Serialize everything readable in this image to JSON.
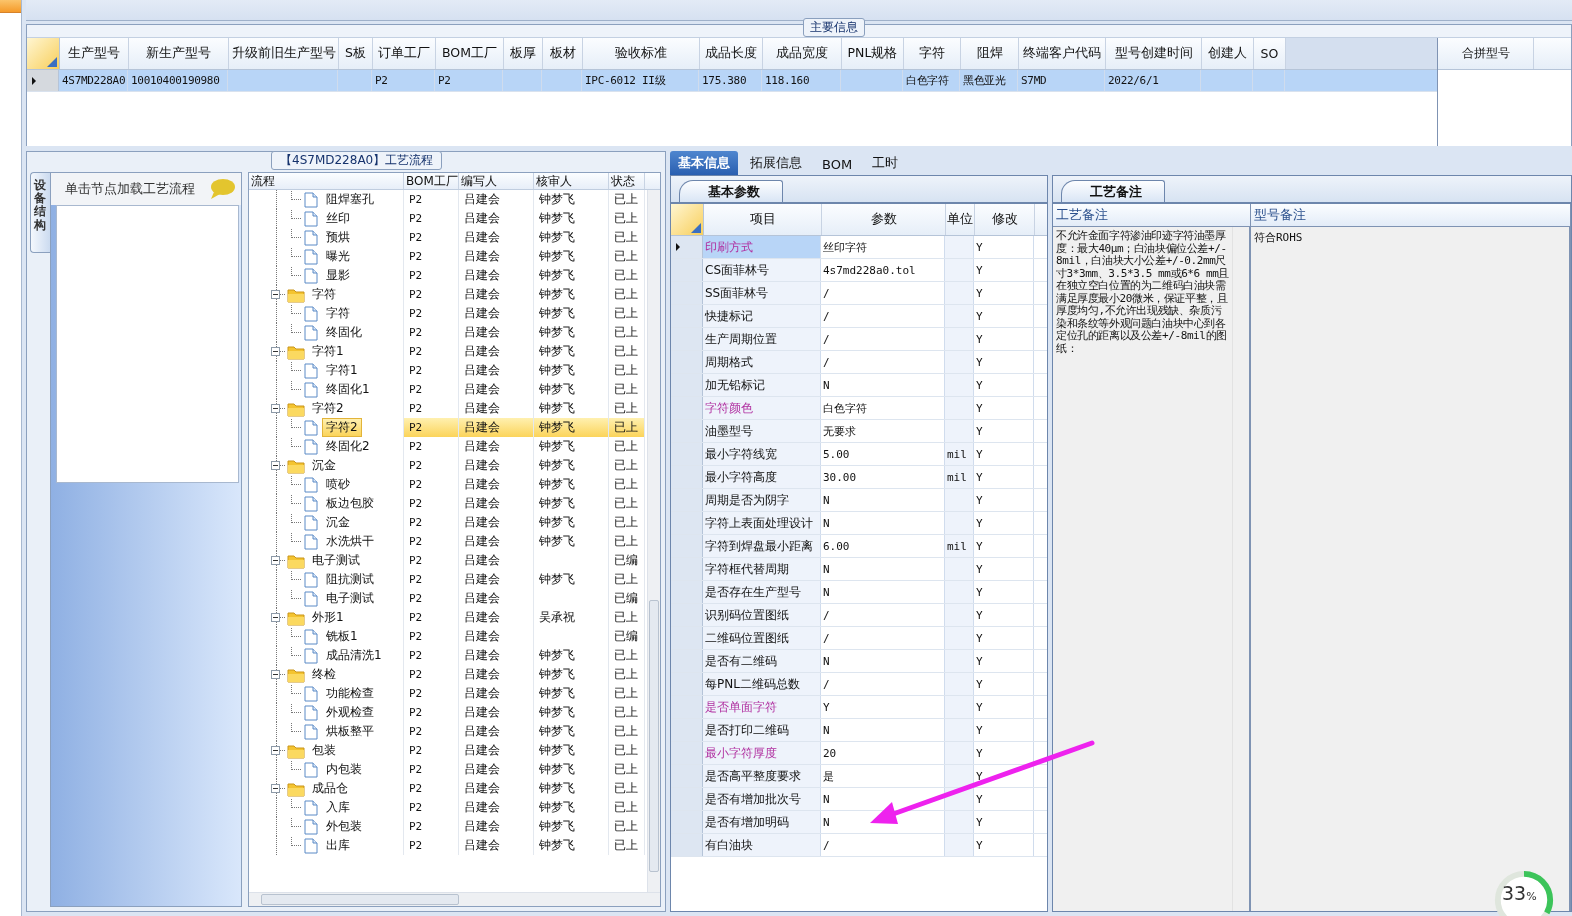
{
  "main_info": {
    "title": "主要信息",
    "columns": [
      "生产型号",
      "新生产型号",
      "升级前旧生产型号",
      "S板",
      "订单工厂",
      "BOM工厂",
      "板厚",
      "板材",
      "验收标准",
      "成品长度",
      "成品宽度",
      "PNL规格",
      "字符",
      "阻焊",
      "终端客户代码",
      "型号创建时间",
      "创建人",
      "SO"
    ],
    "rows": [
      {
        "selected": true,
        "cells": [
          "4S7MD228A0",
          "10010400190980",
          null,
          null,
          "P2",
          "P2",
          null,
          null,
          "IPC-6012 II级",
          "175.380",
          "118.160",
          null,
          "白色字符",
          "黑色亚光",
          "S7MD",
          "2022/6/1",
          null,
          null
        ]
      }
    ],
    "side_columns": [
      "合拼型号"
    ]
  },
  "process": {
    "title": "【4S7MD228A0】工艺流程",
    "side_tab": {
      "label": "设备结构",
      "selected": true
    },
    "hint": "单击节点加载工艺流程",
    "columns": [
      "流程",
      "BOM工厂",
      "编写人",
      "核审人",
      "状态"
    ],
    "orphans": [
      {
        "name": "阻焊塞孔",
        "bom": "P2",
        "author": "吕建会",
        "reviewer": "钟梦飞",
        "status": "已上",
        "selected": false
      },
      {
        "name": "丝印",
        "bom": "P2",
        "author": "吕建会",
        "reviewer": "钟梦飞",
        "status": "已上",
        "selected": false
      },
      {
        "name": "预烘",
        "bom": "P2",
        "author": "吕建会",
        "reviewer": "钟梦飞",
        "status": "已上",
        "selected": false
      },
      {
        "name": "曝光",
        "bom": "P2",
        "author": "吕建会",
        "reviewer": "钟梦飞",
        "status": "已上",
        "selected": false
      },
      {
        "name": "显影",
        "bom": "P2",
        "author": "吕建会",
        "reviewer": "钟梦飞",
        "status": "已上",
        "selected": false
      }
    ],
    "groups": [
      {
        "name": "字符",
        "bom": "P2",
        "author": "吕建会",
        "reviewer": "钟梦飞",
        "status": "已上",
        "selected": false,
        "expanded": true,
        "children": [
          {
            "name": "字符",
            "bom": "P2",
            "author": "吕建会",
            "reviewer": "钟梦飞",
            "status": "已上",
            "selected": false
          },
          {
            "name": "终固化",
            "bom": "P2",
            "author": "吕建会",
            "reviewer": "钟梦飞",
            "status": "已上",
            "selected": false
          }
        ]
      },
      {
        "name": "字符1",
        "bom": "P2",
        "author": "吕建会",
        "reviewer": "钟梦飞",
        "status": "已上",
        "selected": false,
        "expanded": true,
        "children": [
          {
            "name": "字符1",
            "bom": "P2",
            "author": "吕建会",
            "reviewer": "钟梦飞",
            "status": "已上",
            "selected": false
          },
          {
            "name": "终固化1",
            "bom": "P2",
            "author": "吕建会",
            "reviewer": "钟梦飞",
            "status": "已上",
            "selected": false
          }
        ]
      },
      {
        "name": "字符2",
        "bom": "P2",
        "author": "吕建会",
        "reviewer": "钟梦飞",
        "status": "已上",
        "selected": false,
        "expanded": true,
        "children": [
          {
            "name": "字符2",
            "bom": "P2",
            "author": "吕建会",
            "reviewer": "钟梦飞",
            "status": "已上",
            "selected": true
          },
          {
            "name": "终固化2",
            "bom": "P2",
            "author": "吕建会",
            "reviewer": "钟梦飞",
            "status": "已上",
            "selected": false
          }
        ]
      },
      {
        "name": "沉金",
        "bom": "P2",
        "author": "吕建会",
        "reviewer": "钟梦飞",
        "status": "已上",
        "selected": false,
        "expanded": true,
        "children": [
          {
            "name": "喷砂",
            "bom": "P2",
            "author": "吕建会",
            "reviewer": "钟梦飞",
            "status": "已上",
            "selected": false
          },
          {
            "name": "板边包胶",
            "bom": "P2",
            "author": "吕建会",
            "reviewer": "钟梦飞",
            "status": "已上",
            "selected": false
          },
          {
            "name": "沉金",
            "bom": "P2",
            "author": "吕建会",
            "reviewer": "钟梦飞",
            "status": "已上",
            "selected": false
          },
          {
            "name": "水洗烘干",
            "bom": "P2",
            "author": "吕建会",
            "reviewer": "钟梦飞",
            "status": "已上",
            "selected": false
          }
        ]
      },
      {
        "name": "电子测试",
        "bom": "P2",
        "author": "吕建会",
        "status": "已编",
        "selected": false,
        "expanded": true,
        "children": [
          {
            "name": "阻抗测试",
            "bom": "P2",
            "author": "吕建会",
            "reviewer": "钟梦飞",
            "status": "已上",
            "selected": false
          },
          {
            "name": "电子测试",
            "bom": "P2",
            "author": "吕建会",
            "status": "已编",
            "selected": false
          }
        ]
      },
      {
        "name": "外形1",
        "bom": "P2",
        "author": "吕建会",
        "reviewer": "吴承祝",
        "status": "已上",
        "selected": false,
        "expanded": true,
        "children": [
          {
            "name": "铣板1",
            "bom": "P2",
            "author": "吕建会",
            "status": "已编",
            "selected": false
          },
          {
            "name": "成品清洗1",
            "bom": "P2",
            "author": "吕建会",
            "reviewer": "钟梦飞",
            "status": "已上",
            "selected": false
          }
        ]
      },
      {
        "name": "终检",
        "bom": "P2",
        "author": "吕建会",
        "reviewer": "钟梦飞",
        "status": "已上",
        "selected": false,
        "expanded": true,
        "children": [
          {
            "name": "功能检查",
            "bom": "P2",
            "author": "吕建会",
            "reviewer": "钟梦飞",
            "status": "已上",
            "selected": false
          },
          {
            "name": "外观检查",
            "bom": "P2",
            "author": "吕建会",
            "reviewer": "钟梦飞",
            "status": "已上",
            "selected": false
          },
          {
            "name": "烘板整平",
            "bom": "P2",
            "author": "吕建会",
            "reviewer": "钟梦飞",
            "status": "已上",
            "selected": false
          }
        ]
      },
      {
        "name": "包装",
        "bom": "P2",
        "author": "吕建会",
        "reviewer": "钟梦飞",
        "status": "已上",
        "selected": false,
        "expanded": true,
        "children": [
          {
            "name": "内包装",
            "bom": "P2",
            "author": "吕建会",
            "reviewer": "钟梦飞",
            "status": "已上",
            "selected": false
          }
        ]
      },
      {
        "name": "成品仓",
        "bom": "P2",
        "author": "吕建会",
        "reviewer": "钟梦飞",
        "status": "已上",
        "selected": false,
        "expanded": true,
        "children": [
          {
            "name": "入库",
            "bom": "P2",
            "author": "吕建会",
            "reviewer": "钟梦飞",
            "status": "已上",
            "selected": false
          },
          {
            "name": "外包装",
            "bom": "P2",
            "author": "吕建会",
            "reviewer": "钟梦飞",
            "status": "已上",
            "selected": false
          },
          {
            "name": "出库",
            "bom": "P2",
            "author": "吕建会",
            "reviewer": "钟梦飞",
            "status": "已上",
            "selected": false
          }
        ]
      }
    ]
  },
  "detail_tabs": [
    {
      "label": "基本信息",
      "selected": true
    },
    {
      "label": "拓展信息",
      "selected": false
    },
    {
      "label": "BOM",
      "selected": false
    },
    {
      "label": "工时",
      "selected": false
    }
  ],
  "params": {
    "tab": "基本参数",
    "columns": [
      "项目",
      "参数",
      "单位",
      "修改"
    ],
    "rows": [
      {
        "item": "印刷方式",
        "value": "丝印字符",
        "modify": "Y",
        "highlighted": true,
        "selected": true
      },
      {
        "item": "CS面菲林号",
        "value": "4s7md228a0.tol",
        "modify": "Y",
        "highlighted": false,
        "selected": false
      },
      {
        "item": "SS面菲林号",
        "value": "/",
        "modify": "Y",
        "highlighted": false,
        "selected": false
      },
      {
        "item": "快捷标记",
        "value": "/",
        "modify": "Y",
        "highlighted": false,
        "selected": false
      },
      {
        "item": "生产周期位置",
        "value": "/",
        "modify": "Y",
        "highlighted": false,
        "selected": false
      },
      {
        "item": "周期格式",
        "value": "/",
        "modify": "Y",
        "highlighted": false,
        "selected": false
      },
      {
        "item": "加无铅标记",
        "value": "N",
        "modify": "Y",
        "highlighted": false,
        "selected": false
      },
      {
        "item": "字符颜色",
        "value": "白色字符",
        "modify": "Y",
        "highlighted": true,
        "selected": false
      },
      {
        "item": "油墨型号",
        "value": "无要求",
        "modify": "Y",
        "highlighted": false,
        "selected": false
      },
      {
        "item": "最小字符线宽",
        "value": "5.00",
        "unit": "mil",
        "modify": "Y",
        "highlighted": false,
        "selected": false
      },
      {
        "item": "最小字符高度",
        "value": "30.00",
        "unit": "mil",
        "modify": "Y",
        "highlighted": false,
        "selected": false
      },
      {
        "item": "周期是否为阴字",
        "value": "N",
        "modify": "Y",
        "highlighted": false,
        "selected": false
      },
      {
        "item": "字符上表面处理设计",
        "value": "N",
        "modify": "Y",
        "highlighted": false,
        "selected": false
      },
      {
        "item": "字符到焊盘最小距离",
        "value": "6.00",
        "unit": "mil",
        "modify": "Y",
        "highlighted": false,
        "selected": false
      },
      {
        "item": "字符框代替周期",
        "value": "N",
        "modify": "Y",
        "highlighted": false,
        "selected": false
      },
      {
        "item": "是否存在生产型号",
        "value": "N",
        "modify": "Y",
        "highlighted": false,
        "selected": false
      },
      {
        "item": "识别码位置图纸",
        "value": "/",
        "modify": "Y",
        "highlighted": false,
        "selected": false
      },
      {
        "item": "二维码位置图纸",
        "value": "/",
        "modify": "Y",
        "highlighted": false,
        "selected": false
      },
      {
        "item": "是否有二维码",
        "value": "N",
        "modify": "Y",
        "highlighted": false,
        "selected": false
      },
      {
        "item": "每PNL二维码总数",
        "value": "/",
        "modify": "Y",
        "highlighted": false,
        "selected": false
      },
      {
        "item": "是否单面字符",
        "value": "Y",
        "modify": "Y",
        "highlighted": true,
        "selected": false
      },
      {
        "item": "是否打印二维码",
        "value": "N",
        "modify": "Y",
        "highlighted": false,
        "selected": false
      },
      {
        "item": "最小字符厚度",
        "value": "20",
        "modify": "Y",
        "highlighted": true,
        "selected": false
      },
      {
        "item": "是否高平整度要求",
        "value": "是",
        "modify": "Y",
        "highlighted": false,
        "selected": false
      },
      {
        "item": "是否有增加批次号",
        "value": "N",
        "modify": "Y",
        "highlighted": false,
        "selected": false
      },
      {
        "item": "是否有增加明码",
        "value": "N",
        "modify": "Y",
        "highlighted": false,
        "selected": false
      },
      {
        "item": "有白油块",
        "value": "/",
        "modify": "Y",
        "highlighted": false,
        "selected": false
      }
    ]
  },
  "notes": {
    "tab": "工艺备注",
    "columns": [
      "工艺备注",
      "型号备注"
    ],
    "process_note": "不允许金面字符渗油印迹字符油墨厚度：最大40μm；白油块偏位公差+/-8mil，白油块大小公差+/-0.2mm尺寸3*3mm、3.5*3.5 mm或6*6 mm且在独立空白位置的为二维码白油块需满足厚度最小20微米，保证平整，且厚度均匀,不允许出现残缺、杂质污染和条纹等外观问题白油块中心到各定位孔的距离以及公差+/-8mil的图纸：",
    "model_note": "符合ROHS"
  },
  "progress_badge": {
    "value": "33",
    "unit": "%",
    "level": 0.33
  }
}
